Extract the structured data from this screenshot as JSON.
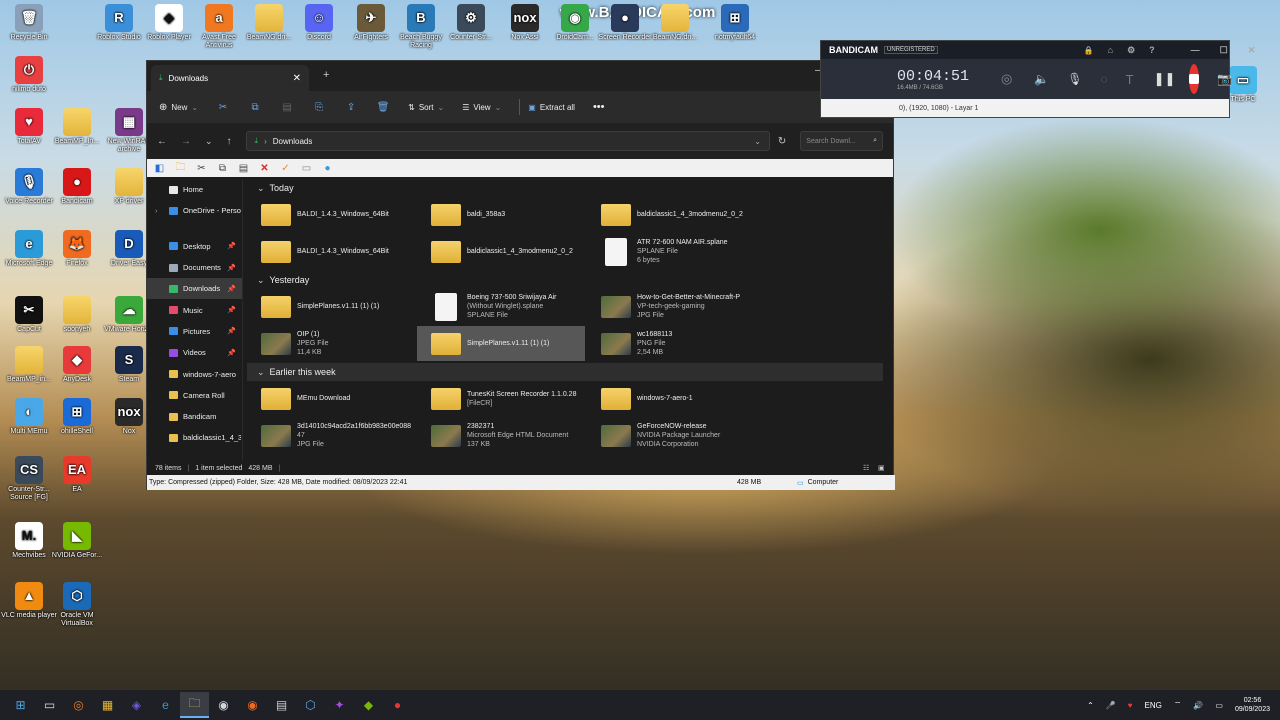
{
  "desktop_icons": [
    {
      "label": "Recycle Bin",
      "glyph": "🗑",
      "color": "#8aa0b8"
    },
    {
      "label": "Roblox Studio",
      "glyph": "R",
      "color": "#3b8fd8"
    },
    {
      "label": "Roblox Player",
      "glyph": "◆",
      "color": "#ffffff"
    },
    {
      "label": "Avast Free Antivirus",
      "glyph": "a",
      "color": "#f07820"
    },
    {
      "label": "BeamNG.dri...",
      "glyph": "",
      "color": "folder"
    },
    {
      "label": "Discord",
      "glyph": "☺",
      "color": "#5865f2"
    },
    {
      "label": "AirFighters",
      "glyph": "✈",
      "color": "#6a5a3a"
    },
    {
      "label": "Beach Buggy Racing",
      "glyph": "B",
      "color": "#2a7ab8"
    },
    {
      "label": "Counter-Str...",
      "glyph": "⚙",
      "color": "#3a4a5a"
    },
    {
      "label": "Nox Assi",
      "glyph": "nox",
      "color": "#2a2a2a"
    },
    {
      "label": "DroidCam...",
      "glyph": "◉",
      "color": "#36a84a"
    },
    {
      "label": "Screen Recorder",
      "glyph": "●",
      "color": "#2a3a5a"
    },
    {
      "label": "BeamNG.dri...",
      "glyph": "",
      "color": "folder"
    },
    {
      "label": "notmyfault64",
      "glyph": "⊞",
      "color": "#2a6ab8"
    },
    {
      "label": "nilimo duto",
      "glyph": "⏻",
      "color": "#e84040"
    },
    {
      "label": "TotalAV",
      "glyph": "♥",
      "color": "#e82a3a"
    },
    {
      "label": "BeamMP_In...",
      "glyph": "",
      "color": "folder"
    },
    {
      "label": "New WinRAR archive",
      "glyph": "▦",
      "color": "#7a3a8a"
    },
    {
      "label": "Voice Recorder",
      "glyph": "🎙",
      "color": "#2a7ad8"
    },
    {
      "label": "Bandicam",
      "glyph": "●",
      "color": "#d81818"
    },
    {
      "label": "XP driver",
      "glyph": "",
      "color": "folder"
    },
    {
      "label": "Microsoft Edge",
      "glyph": "e",
      "color": "#2a9ad8"
    },
    {
      "label": "Firefox",
      "glyph": "🦊",
      "color": "#f06a20"
    },
    {
      "label": "Driver Easy",
      "glyph": "D",
      "color": "#1a5ab8"
    },
    {
      "label": "CapCut",
      "glyph": "✂",
      "color": "#111111"
    },
    {
      "label": "soonyeh",
      "glyph": "",
      "color": "folder"
    },
    {
      "label": "VMware Horiz...",
      "glyph": "☁",
      "color": "#3aa83a"
    },
    {
      "label": "BeamMP_in...",
      "glyph": "",
      "color": "folder"
    },
    {
      "label": "AnyDesk",
      "glyph": "◆",
      "color": "#e83a3a"
    },
    {
      "label": "Steam",
      "glyph": "S",
      "color": "#1a2a4a"
    },
    {
      "label": "Multi MEmu",
      "glyph": "◐",
      "color": "#4aa8e8"
    },
    {
      "label": "ohilleShell",
      "glyph": "⊞",
      "color": "#1a6ad8"
    },
    {
      "label": "Nox",
      "glyph": "nox",
      "color": "#2a2a2a"
    },
    {
      "label": "Counter-Str... Source [FG]",
      "glyph": "CS",
      "color": "#3a4a5a"
    },
    {
      "label": "EA",
      "glyph": "EA",
      "color": "#e83a2a"
    },
    {
      "label": "Mechvibes",
      "glyph": "M.",
      "color": "#ffffff"
    },
    {
      "label": "NVIDIA GeFor...",
      "glyph": "◣",
      "color": "#76b900"
    },
    {
      "label": "VLC media player",
      "glyph": "▲",
      "color": "#f08a10"
    },
    {
      "label": "Oracle VM VirtualBox",
      "glyph": "⬡",
      "color": "#1a6ab8"
    },
    {
      "label": "This PC",
      "glyph": "▭",
      "color": "#4ab8e8"
    }
  ],
  "explorer": {
    "tab_title": "Downloads",
    "commands": {
      "new": "New",
      "sort": "Sort",
      "view": "View",
      "extract": "Extract all"
    },
    "path": "Downloads",
    "search_placeholder": "Search Downl...",
    "sidebar": [
      {
        "label": "Home",
        "icon": "home-icon",
        "color": "#e8e8e8",
        "pin": false,
        "chev": false
      },
      {
        "label": "OneDrive - Perso",
        "icon": "cloud-icon",
        "color": "#3a8ee6",
        "pin": false,
        "chev": true
      },
      {
        "label": "",
        "icon": "",
        "color": "",
        "pin": false,
        "chev": false
      },
      {
        "label": "Desktop",
        "icon": "desktop-icon",
        "color": "#3a8ee6",
        "pin": true,
        "chev": false
      },
      {
        "label": "Documents",
        "icon": "documents-icon",
        "color": "#9aa8b8",
        "pin": true,
        "chev": false
      },
      {
        "label": "Downloads",
        "icon": "download-icon",
        "color": "#3ab86a",
        "pin": true,
        "chev": false
      },
      {
        "label": "Music",
        "icon": "music-icon",
        "color": "#e84a6a",
        "pin": true,
        "chev": false
      },
      {
        "label": "Pictures",
        "icon": "pictures-icon",
        "color": "#3a8ee6",
        "pin": true,
        "chev": false
      },
      {
        "label": "Videos",
        "icon": "videos-icon",
        "color": "#9a4ae6",
        "pin": true,
        "chev": false
      },
      {
        "label": "windows-7-aero",
        "icon": "folder-icon",
        "color": "#e8c050",
        "pin": false,
        "chev": false
      },
      {
        "label": "Camera Roll",
        "icon": "folder-icon",
        "color": "#e8c050",
        "pin": false,
        "chev": false
      },
      {
        "label": "Bandicam",
        "icon": "folder-icon",
        "color": "#e8c050",
        "pin": false,
        "chev": false
      },
      {
        "label": "baldiclassic1_4_3",
        "icon": "folder-icon",
        "color": "#e8c050",
        "pin": false,
        "chev": false
      }
    ],
    "groups": {
      "today": "Today",
      "yesterday": "Yesterday",
      "earlier": "Earlier this week"
    },
    "today": [
      [
        {
          "name": "BALDI_1.4.3_Windows_64Bit",
          "l2": "",
          "l3": "",
          "k": "f"
        },
        {
          "name": "baldi_358a3",
          "l2": "",
          "l3": "",
          "k": "f"
        },
        {
          "name": "baldiclassic1_4_3modmenu2_0_2",
          "l2": "",
          "l3": "",
          "k": "f"
        }
      ],
      [
        {
          "name": "BALDI_1.4.3_Windows_64Bit",
          "l2": "",
          "l3": "",
          "k": "f"
        },
        {
          "name": "baldiclassic1_4_3modmenu2_0_2",
          "l2": "",
          "l3": "",
          "k": "f"
        },
        {
          "name": "ATR 72-600 NAM AIR.splane",
          "l2": "SPLANE File",
          "l3": "6 bytes",
          "k": "doc"
        }
      ]
    ],
    "yesterday": [
      [
        {
          "name": "SimplePlanes.v1.11 (1) (1)",
          "l2": "",
          "l3": "",
          "k": "f"
        },
        {
          "name": "Boeing 737-500 Sriwijaya Air",
          "l2": "(Without Winglet).splane",
          "l3": "SPLANE File",
          "k": "doc"
        },
        {
          "name": "How-to-Get-Better-at-Minecraft-P",
          "l2": "VP-tech-geek-gaming",
          "l3": "JPG File",
          "k": "img"
        }
      ],
      [
        {
          "name": "OIP (1)",
          "l2": "JPEG File",
          "l3": "11,4 KB",
          "k": "img"
        },
        {
          "name": "SimplePlanes.v1.11 (1) (1)",
          "l2": "",
          "l3": "",
          "k": "f",
          "sel": true
        },
        {
          "name": "wc1688113",
          "l2": "PNG File",
          "l3": "2,54 MB",
          "k": "img"
        }
      ]
    ],
    "earlier": [
      [
        {
          "name": "MEmu Download",
          "l2": "",
          "l3": "",
          "k": "f"
        },
        {
          "name": "TunesKit Screen Recorder 1.1.0.28",
          "l2": "[FileCR]",
          "l3": "",
          "k": "f"
        },
        {
          "name": "windows-7-aero-1",
          "l2": "",
          "l3": "",
          "k": "f"
        }
      ],
      [
        {
          "name": "3d14010c94acd2a1f6bb983e00e088",
          "l2": "47",
          "l3": "JPG File",
          "k": "img"
        },
        {
          "name": "2382371",
          "l2": "Microsoft Edge HTML Document",
          "l3": "137 KB",
          "k": "img"
        },
        {
          "name": "GeForceNOW-release",
          "l2": "NVIDIA Package Launcher",
          "l3": "NVIDIA Corporation",
          "k": "img"
        }
      ]
    ],
    "status_items": "78 items",
    "status_selected": "1 item selected",
    "status_size": "428 MB",
    "hint": "Type: Compressed (zipped) Folder, Size: 428 MB, Date modified: 08/09/2023 22:41",
    "hint_size": "428 MB",
    "hint_loc": "Computer"
  },
  "bandicam": {
    "brand": "BANDICAM",
    "badge": "UNREGISTERED",
    "timer": "00:04:51",
    "sizes": "16.4MB / 74.6GB",
    "target": "0), (1920, 1080) - Layar 1"
  },
  "watermark": "www.BANDICAM.com",
  "tray": {
    "lang": "ENG",
    "time": "02:56",
    "date": "09/09/2023"
  }
}
